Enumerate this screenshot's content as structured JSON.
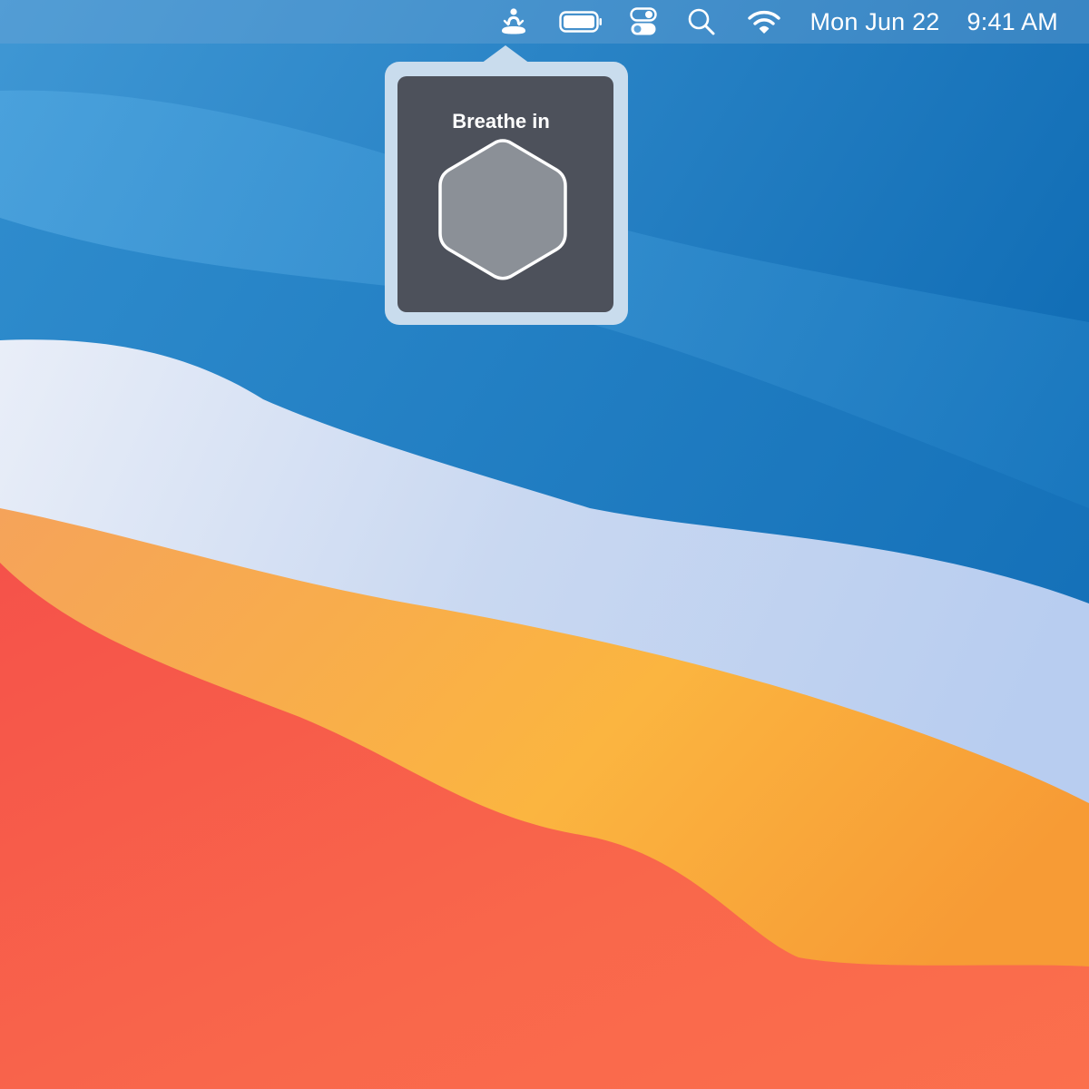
{
  "menubar": {
    "icons": {
      "breathe": "meditation-figure-icon",
      "battery": "battery-icon",
      "control_center": "control-center-icon",
      "search": "search-icon",
      "wifi": "wifi-icon"
    },
    "date": "Mon Jun 22",
    "time": "9:41 AM"
  },
  "popover": {
    "label": "Breathe in",
    "shape_icon": "hexagon-breathing-icon"
  },
  "colors": {
    "menubar_text": "#ffffff",
    "popover_frame": "#c9dced",
    "popover_panel": "#4d515b",
    "hexagon_fill": "#8b9097",
    "hexagon_stroke": "#ffffff"
  }
}
